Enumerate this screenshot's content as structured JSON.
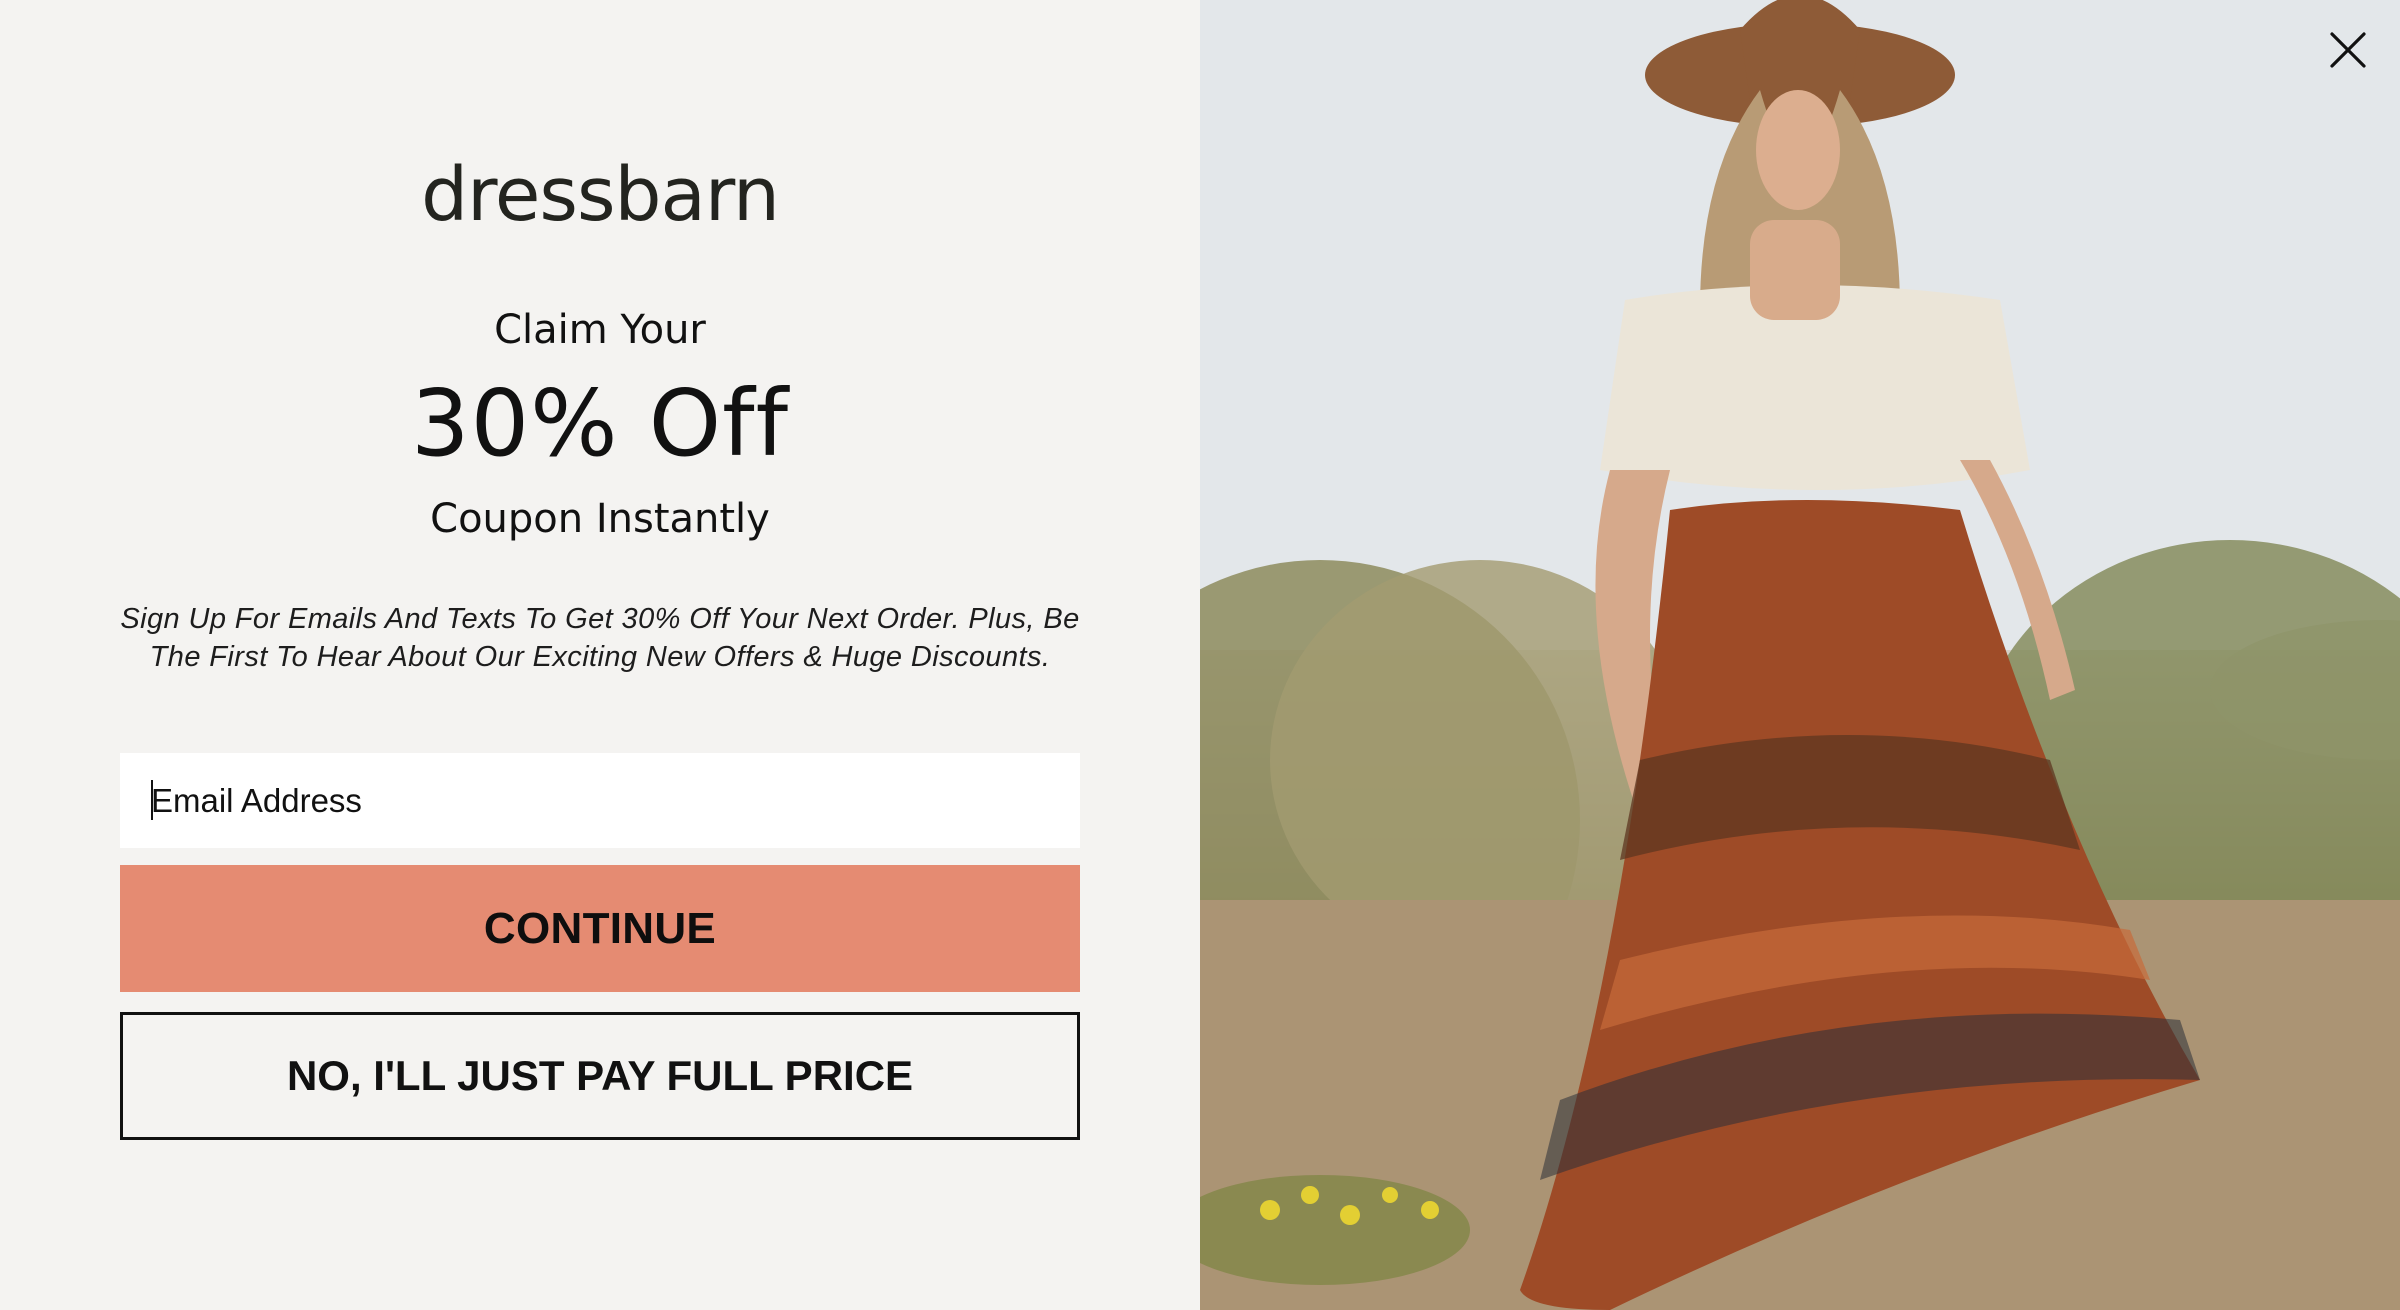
{
  "brand": {
    "logo_text": "dressbarn"
  },
  "offer": {
    "line1": "Claim Your",
    "line2": "30% Off",
    "line3": "Coupon Instantly"
  },
  "description": "Sign Up For Emails And Texts To Get 30% Off Your Next Order. Plus, Be The First To Hear About Our Exciting New Offers & Huge Discounts.",
  "form": {
    "email_placeholder": "Email Address",
    "continue_label": "CONTINUE",
    "decline_label": "NO, I'LL JUST PAY FULL PRICE"
  },
  "icons": {
    "close": "close-icon"
  },
  "colors": {
    "panel_background": "#f4f3f1",
    "continue_button": "#e58b72",
    "text": "#111111"
  }
}
